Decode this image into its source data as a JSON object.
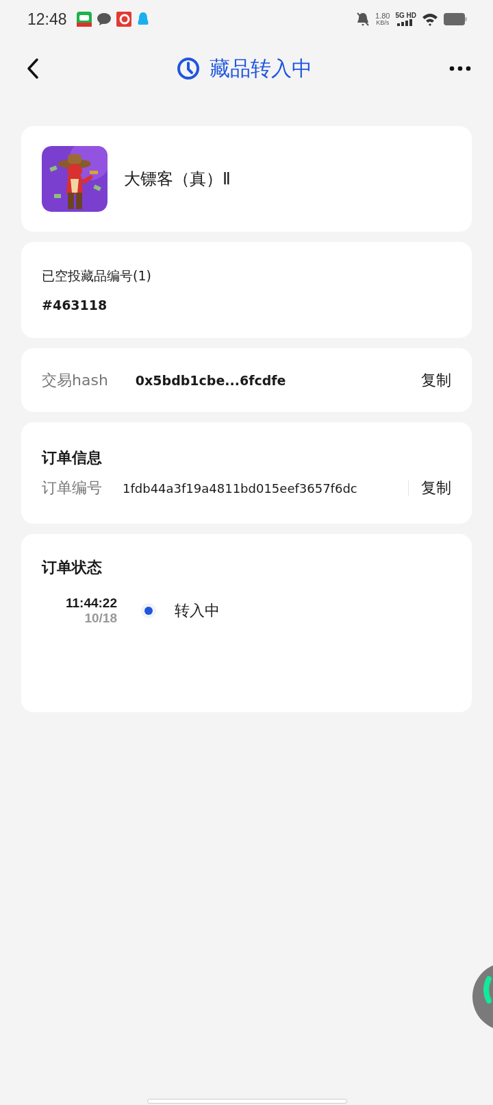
{
  "status_bar": {
    "time": "12:48",
    "net_speed": "1.80",
    "net_unit": "KB/s",
    "network": "5G HD"
  },
  "header": {
    "title": "藏品转入中"
  },
  "collectible": {
    "name": "大镖客（真）Ⅱ"
  },
  "airdrop": {
    "label": "已空投藏品编号(1)",
    "number": "#463118"
  },
  "transaction": {
    "label": "交易hash",
    "value": "0x5bdb1cbe...6fcdfe",
    "copy": "复制"
  },
  "order_info": {
    "title": "订单信息",
    "label": "订单编号",
    "value": "1fdb44a3f19a4811bd015eef3657f6dc",
    "copy": "复制"
  },
  "order_status": {
    "title": "订单状态",
    "timeline": [
      {
        "time": "11:44:22",
        "date": "10/18",
        "status": "转入中",
        "color": "#1f55e0"
      }
    ]
  }
}
